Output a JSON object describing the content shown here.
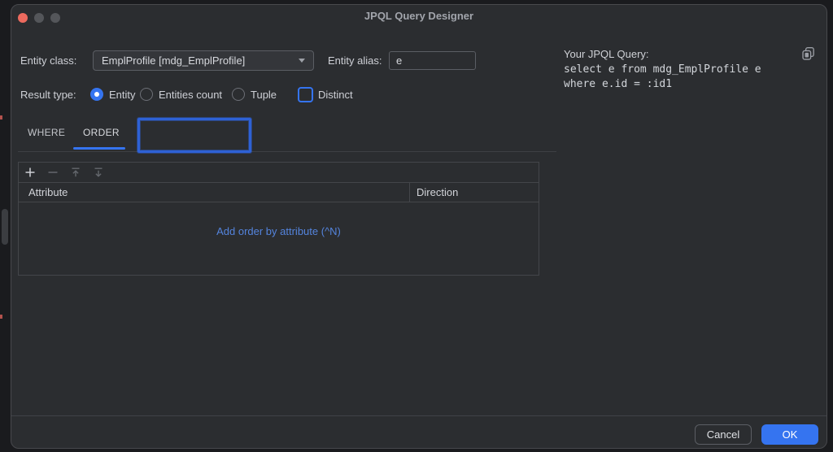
{
  "window": {
    "title": "JPQL Query Designer",
    "traffic_lights": [
      "close",
      "minimize",
      "zoom"
    ]
  },
  "form": {
    "entity_class": {
      "label": "Entity class:",
      "value": "EmplProfile [mdg_EmplProfile]"
    },
    "entity_alias": {
      "label": "Entity alias:",
      "value": "e"
    },
    "result_type": {
      "label": "Result type:",
      "options": [
        {
          "label": "Entity",
          "selected": true
        },
        {
          "label": "Entities count",
          "selected": false
        },
        {
          "label": "Tuple",
          "selected": false
        }
      ]
    },
    "distinct": {
      "label": "Distinct",
      "checked": false
    }
  },
  "tabs": [
    {
      "label": "WHERE",
      "active": false
    },
    {
      "label": "ORDER",
      "active": true
    }
  ],
  "order_table": {
    "toolbar_icons": [
      "plus-icon",
      "minus-icon",
      "move-up-icon",
      "move-down-icon"
    ],
    "columns": [
      "Attribute",
      "Direction"
    ],
    "rows": [],
    "empty_state_link": "Add order by attribute (^N)"
  },
  "query_panel": {
    "label": "Your JPQL Query:",
    "copy_icon": "copy-icon",
    "lines": [
      "select e from mdg_EmplProfile e",
      "where e.id = :id1"
    ]
  },
  "footer": {
    "cancel": "Cancel",
    "ok": "OK"
  },
  "colors": {
    "accent": "#3574f0",
    "link_blue": "#5484dd",
    "dialog_bg": "#2b2d30",
    "outer_bg": "#1a1b1e",
    "close_red": "#ec6a5e",
    "annotation_blue": "#2e61d5"
  }
}
